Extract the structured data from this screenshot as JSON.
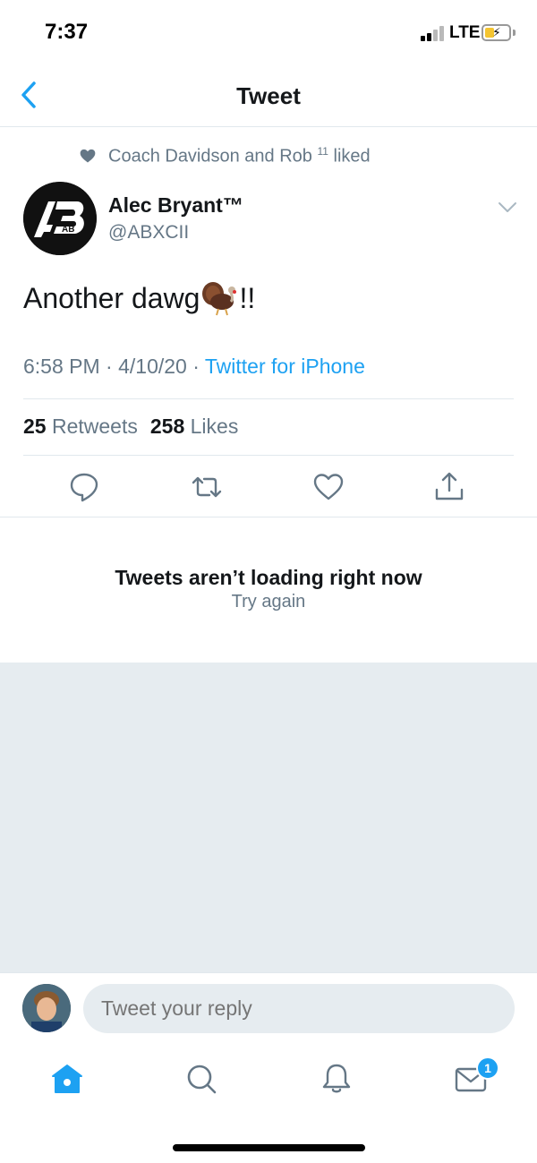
{
  "status_bar": {
    "time": "7:37",
    "network": "LTE",
    "battery_color": "#f4c430"
  },
  "nav": {
    "title": "Tweet",
    "back_icon": "chevron-left-icon"
  },
  "tweet": {
    "social_context": {
      "text_before_sup": "Coach Davidson and Rob ",
      "sup": "11",
      "text_after_sup": " liked"
    },
    "author": {
      "name": "Alec Bryant™",
      "handle": "@ABXCII",
      "avatar_text": "AB"
    },
    "text_before_emoji": "Another dawg",
    "emoji": "turkey-emoji",
    "text_after_emoji": "!!",
    "time": "6:58 PM",
    "date": "4/10/20",
    "separator": " · ",
    "source": "Twitter for iPhone",
    "retweets_count": "25",
    "retweets_label": "Retweets",
    "likes_count": "258",
    "likes_label": "Likes"
  },
  "actions": [
    "reply-icon",
    "retweet-icon",
    "like-icon",
    "share-icon"
  ],
  "error": {
    "title": "Tweets aren’t loading right now",
    "retry": "Try again"
  },
  "reply": {
    "placeholder": "Tweet your reply"
  },
  "tab_bar": {
    "tabs": [
      "home-icon",
      "search-icon",
      "notifications-icon",
      "messages-icon"
    ],
    "messages_badge": "1"
  },
  "colors": {
    "accent": "#1da1f2",
    "secondary_text": "#657786",
    "divider": "#e1e8ed",
    "background_gray": "#e6ecf0"
  }
}
